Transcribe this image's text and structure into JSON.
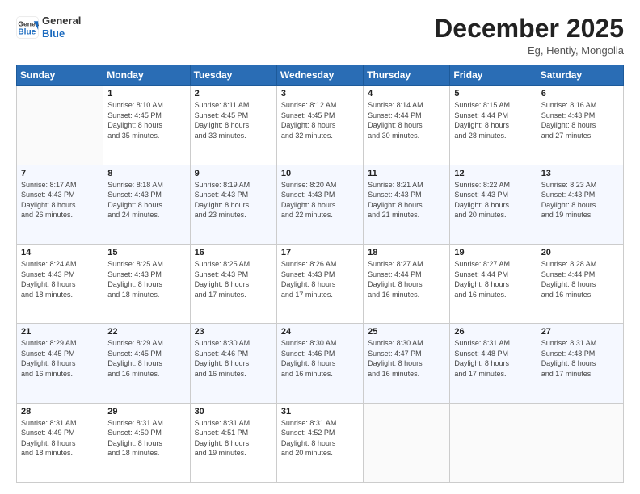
{
  "logo": {
    "line1": "General",
    "line2": "Blue"
  },
  "header": {
    "month": "December 2025",
    "location": "Eg, Hentiy, Mongolia"
  },
  "weekdays": [
    "Sunday",
    "Monday",
    "Tuesday",
    "Wednesday",
    "Thursday",
    "Friday",
    "Saturday"
  ],
  "weeks": [
    [
      {
        "day": "",
        "info": ""
      },
      {
        "day": "1",
        "info": "Sunrise: 8:10 AM\nSunset: 4:45 PM\nDaylight: 8 hours\nand 35 minutes."
      },
      {
        "day": "2",
        "info": "Sunrise: 8:11 AM\nSunset: 4:45 PM\nDaylight: 8 hours\nand 33 minutes."
      },
      {
        "day": "3",
        "info": "Sunrise: 8:12 AM\nSunset: 4:45 PM\nDaylight: 8 hours\nand 32 minutes."
      },
      {
        "day": "4",
        "info": "Sunrise: 8:14 AM\nSunset: 4:44 PM\nDaylight: 8 hours\nand 30 minutes."
      },
      {
        "day": "5",
        "info": "Sunrise: 8:15 AM\nSunset: 4:44 PM\nDaylight: 8 hours\nand 28 minutes."
      },
      {
        "day": "6",
        "info": "Sunrise: 8:16 AM\nSunset: 4:43 PM\nDaylight: 8 hours\nand 27 minutes."
      }
    ],
    [
      {
        "day": "7",
        "info": "Sunrise: 8:17 AM\nSunset: 4:43 PM\nDaylight: 8 hours\nand 26 minutes."
      },
      {
        "day": "8",
        "info": "Sunrise: 8:18 AM\nSunset: 4:43 PM\nDaylight: 8 hours\nand 24 minutes."
      },
      {
        "day": "9",
        "info": "Sunrise: 8:19 AM\nSunset: 4:43 PM\nDaylight: 8 hours\nand 23 minutes."
      },
      {
        "day": "10",
        "info": "Sunrise: 8:20 AM\nSunset: 4:43 PM\nDaylight: 8 hours\nand 22 minutes."
      },
      {
        "day": "11",
        "info": "Sunrise: 8:21 AM\nSunset: 4:43 PM\nDaylight: 8 hours\nand 21 minutes."
      },
      {
        "day": "12",
        "info": "Sunrise: 8:22 AM\nSunset: 4:43 PM\nDaylight: 8 hours\nand 20 minutes."
      },
      {
        "day": "13",
        "info": "Sunrise: 8:23 AM\nSunset: 4:43 PM\nDaylight: 8 hours\nand 19 minutes."
      }
    ],
    [
      {
        "day": "14",
        "info": "Sunrise: 8:24 AM\nSunset: 4:43 PM\nDaylight: 8 hours\nand 18 minutes."
      },
      {
        "day": "15",
        "info": "Sunrise: 8:25 AM\nSunset: 4:43 PM\nDaylight: 8 hours\nand 18 minutes."
      },
      {
        "day": "16",
        "info": "Sunrise: 8:25 AM\nSunset: 4:43 PM\nDaylight: 8 hours\nand 17 minutes."
      },
      {
        "day": "17",
        "info": "Sunrise: 8:26 AM\nSunset: 4:43 PM\nDaylight: 8 hours\nand 17 minutes."
      },
      {
        "day": "18",
        "info": "Sunrise: 8:27 AM\nSunset: 4:44 PM\nDaylight: 8 hours\nand 16 minutes."
      },
      {
        "day": "19",
        "info": "Sunrise: 8:27 AM\nSunset: 4:44 PM\nDaylight: 8 hours\nand 16 minutes."
      },
      {
        "day": "20",
        "info": "Sunrise: 8:28 AM\nSunset: 4:44 PM\nDaylight: 8 hours\nand 16 minutes."
      }
    ],
    [
      {
        "day": "21",
        "info": "Sunrise: 8:29 AM\nSunset: 4:45 PM\nDaylight: 8 hours\nand 16 minutes."
      },
      {
        "day": "22",
        "info": "Sunrise: 8:29 AM\nSunset: 4:45 PM\nDaylight: 8 hours\nand 16 minutes."
      },
      {
        "day": "23",
        "info": "Sunrise: 8:30 AM\nSunset: 4:46 PM\nDaylight: 8 hours\nand 16 minutes."
      },
      {
        "day": "24",
        "info": "Sunrise: 8:30 AM\nSunset: 4:46 PM\nDaylight: 8 hours\nand 16 minutes."
      },
      {
        "day": "25",
        "info": "Sunrise: 8:30 AM\nSunset: 4:47 PM\nDaylight: 8 hours\nand 16 minutes."
      },
      {
        "day": "26",
        "info": "Sunrise: 8:31 AM\nSunset: 4:48 PM\nDaylight: 8 hours\nand 17 minutes."
      },
      {
        "day": "27",
        "info": "Sunrise: 8:31 AM\nSunset: 4:48 PM\nDaylight: 8 hours\nand 17 minutes."
      }
    ],
    [
      {
        "day": "28",
        "info": "Sunrise: 8:31 AM\nSunset: 4:49 PM\nDaylight: 8 hours\nand 18 minutes."
      },
      {
        "day": "29",
        "info": "Sunrise: 8:31 AM\nSunset: 4:50 PM\nDaylight: 8 hours\nand 18 minutes."
      },
      {
        "day": "30",
        "info": "Sunrise: 8:31 AM\nSunset: 4:51 PM\nDaylight: 8 hours\nand 19 minutes."
      },
      {
        "day": "31",
        "info": "Sunrise: 8:31 AM\nSunset: 4:52 PM\nDaylight: 8 hours\nand 20 minutes."
      },
      {
        "day": "",
        "info": ""
      },
      {
        "day": "",
        "info": ""
      },
      {
        "day": "",
        "info": ""
      }
    ]
  ]
}
